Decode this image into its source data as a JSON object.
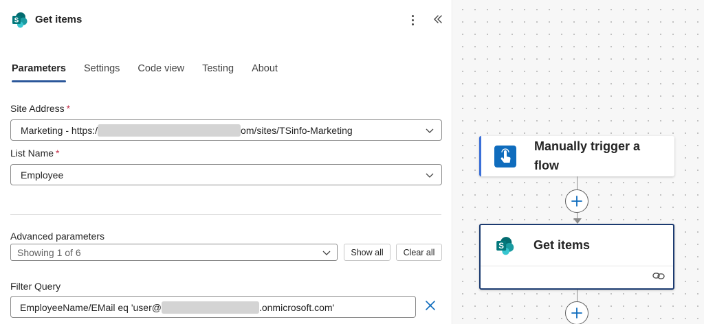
{
  "panel": {
    "title": "Get items",
    "tabs": [
      {
        "label": "Parameters",
        "active": true
      },
      {
        "label": "Settings",
        "active": false
      },
      {
        "label": "Code view",
        "active": false
      },
      {
        "label": "Testing",
        "active": false
      },
      {
        "label": "About",
        "active": false
      }
    ],
    "site_address": {
      "label": "Site Address",
      "required_mark": "*",
      "value_prefix": "Marketing - https:/",
      "value_suffix": "om/sites/TSinfo-Marketing"
    },
    "list_name": {
      "label": "List Name",
      "required_mark": "*",
      "value": "Employee"
    },
    "advanced": {
      "label": "Advanced parameters",
      "value": "Showing 1 of 6",
      "show_all_label": "Show all",
      "clear_all_label": "Clear all"
    },
    "filter_query": {
      "label": "Filter Query",
      "value_prefix": "EmployeeName/EMail eq 'user@",
      "value_suffix": ".onmicrosoft.com'"
    }
  },
  "canvas": {
    "trigger_card": {
      "title": "Manually trigger a flow"
    },
    "action_card": {
      "title": "Get items"
    }
  },
  "colors": {
    "accent": "#0f6cbd",
    "tab_indicator": "#2b579a",
    "required": "#c4314b",
    "selected_card_border": "#1b3a70",
    "sharepoint_teal": "#038387"
  }
}
